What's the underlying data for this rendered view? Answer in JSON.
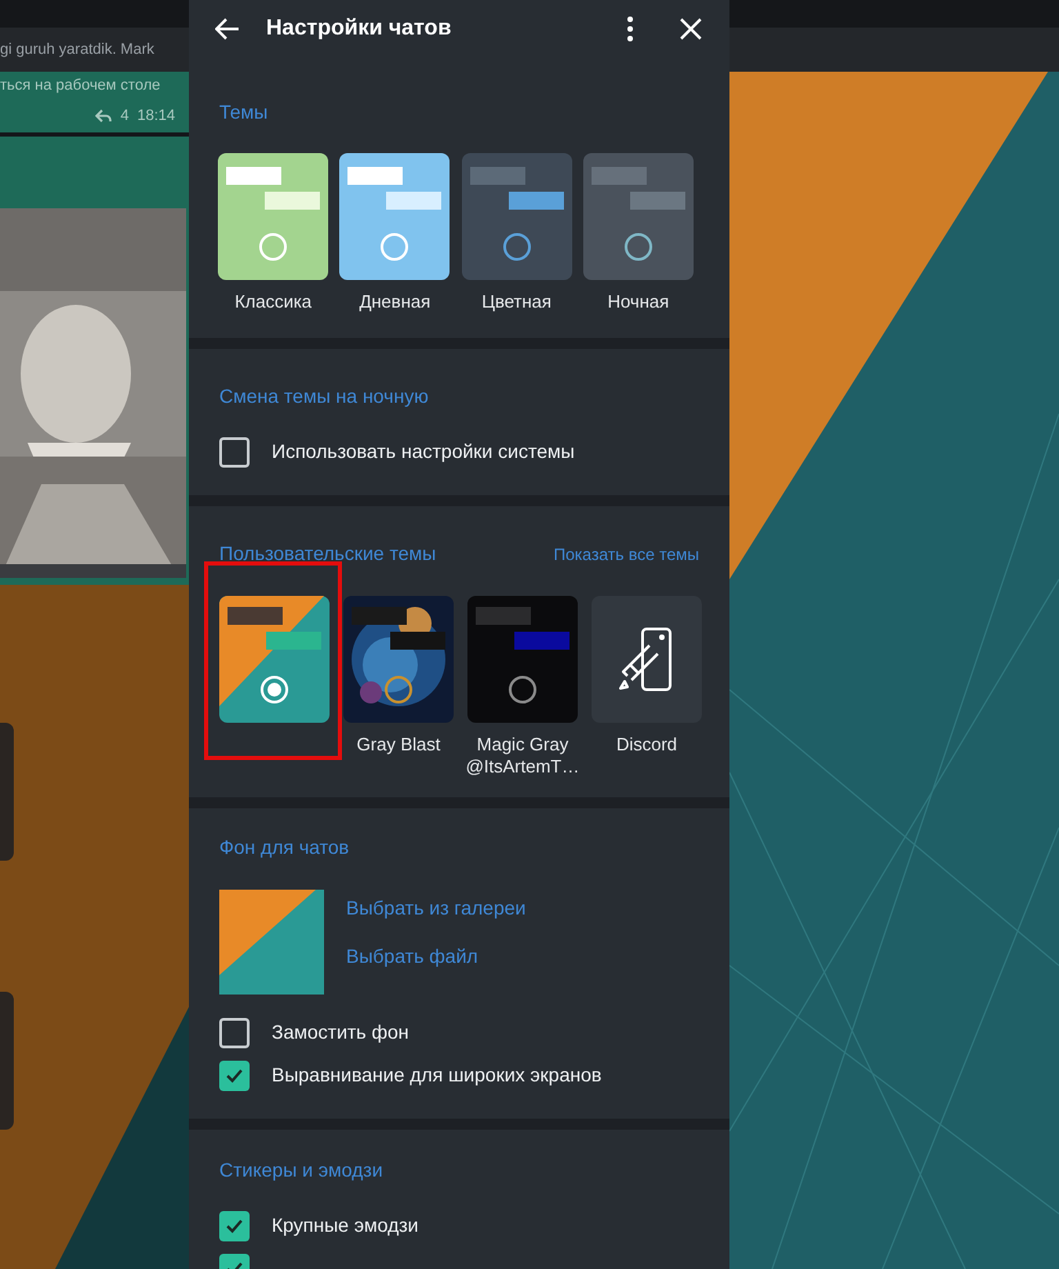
{
  "chat_preview": {
    "top_text": "gi guruh yaratdik.  Mark",
    "message_text": "ться на рабочем столе",
    "reply_count": "4",
    "time": "18:14"
  },
  "settings_panel": {
    "title": "Настройки чатов"
  },
  "themes": {
    "title": "Темы",
    "items": [
      {
        "label": "Классика",
        "kind": "classic",
        "selected": false
      },
      {
        "label": "Дневная",
        "kind": "day",
        "selected": false
      },
      {
        "label": "Цветная",
        "kind": "tinted",
        "selected": false
      },
      {
        "label": "Ночная",
        "kind": "night",
        "selected": false
      }
    ]
  },
  "night_switch": {
    "title": "Смена темы на ночную",
    "options": [
      {
        "label": "Использовать настройки системы",
        "checked": false
      }
    ]
  },
  "custom_themes": {
    "title": "Пользовательские темы",
    "link": "Показать все темы",
    "items": [
      {
        "kind": "wallpaper",
        "selected": true,
        "highlighted": true
      },
      {
        "label": "Gray Blast",
        "kind": "space",
        "selected": false,
        "highlighted": false
      },
      {
        "label": "Magic Gray @ItsArtemT…",
        "kind": "dark",
        "selected": false,
        "highlighted": false
      },
      {
        "label": "Discord",
        "kind": "editor",
        "selected": false,
        "highlighted": false
      }
    ]
  },
  "chat_background": {
    "title": "Фон для чатов",
    "links": [
      "Выбрать из галереи",
      "Выбрать файл"
    ],
    "options": [
      {
        "label": "Замостить фон",
        "checked": false
      },
      {
        "label": "Выравнивание для широких экранов",
        "checked": true
      }
    ]
  },
  "stickers": {
    "title": "Стикеры и эмодзи",
    "options": [
      {
        "label": "Крупные эмодзи",
        "checked": true
      },
      {
        "checked": true
      }
    ]
  }
}
